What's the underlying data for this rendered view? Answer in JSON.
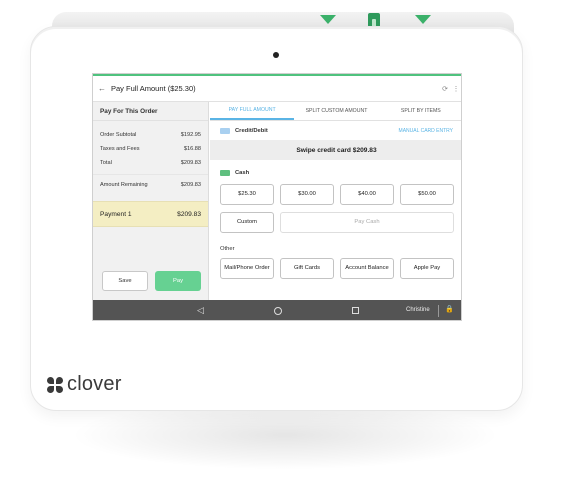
{
  "device": {
    "brand": "clover"
  },
  "appbar": {
    "title": "Pay Full Amount ($25.30)"
  },
  "order": {
    "heading": "Pay For This Order",
    "subtotal_label": "Order Subtotal",
    "subtotal_value": "$192.95",
    "tax_label": "Taxes and Fees",
    "tax_value": "$16.88",
    "total_label": "Total",
    "total_value": "$209.83",
    "remaining_label": "Amount Remaining",
    "remaining_value": "$209.83",
    "payment_label": "Payment 1",
    "payment_value": "$209.83",
    "save_label": "Save",
    "pay_label": "Pay"
  },
  "tabs": [
    {
      "label": "PAY FULL AMOUNT",
      "active": true
    },
    {
      "label": "SPLIT CUSTOM AMOUNT",
      "active": false
    },
    {
      "label": "SPLIT BY ITEMS",
      "active": false
    }
  ],
  "credit": {
    "label": "Credit/Debit",
    "manual_entry": "MANUAL CARD ENTRY",
    "swipe_prompt": "Swipe credit card $209.83"
  },
  "cash": {
    "label": "Cash",
    "amounts": [
      "$25.30",
      "$30.00",
      "$40.00",
      "$50.00"
    ],
    "custom_label": "Custom",
    "pay_cash_label": "Pay Cash"
  },
  "other": {
    "label": "Other",
    "options": [
      "Mail/Phone Order",
      "Gift Cards",
      "Account Balance",
      "Apple Pay"
    ]
  },
  "navbar": {
    "user": "Christine"
  },
  "colors": {
    "accent_green": "#66d192",
    "accent_blue": "#5ab4e5",
    "payment_highlight": "#f4eec3"
  }
}
